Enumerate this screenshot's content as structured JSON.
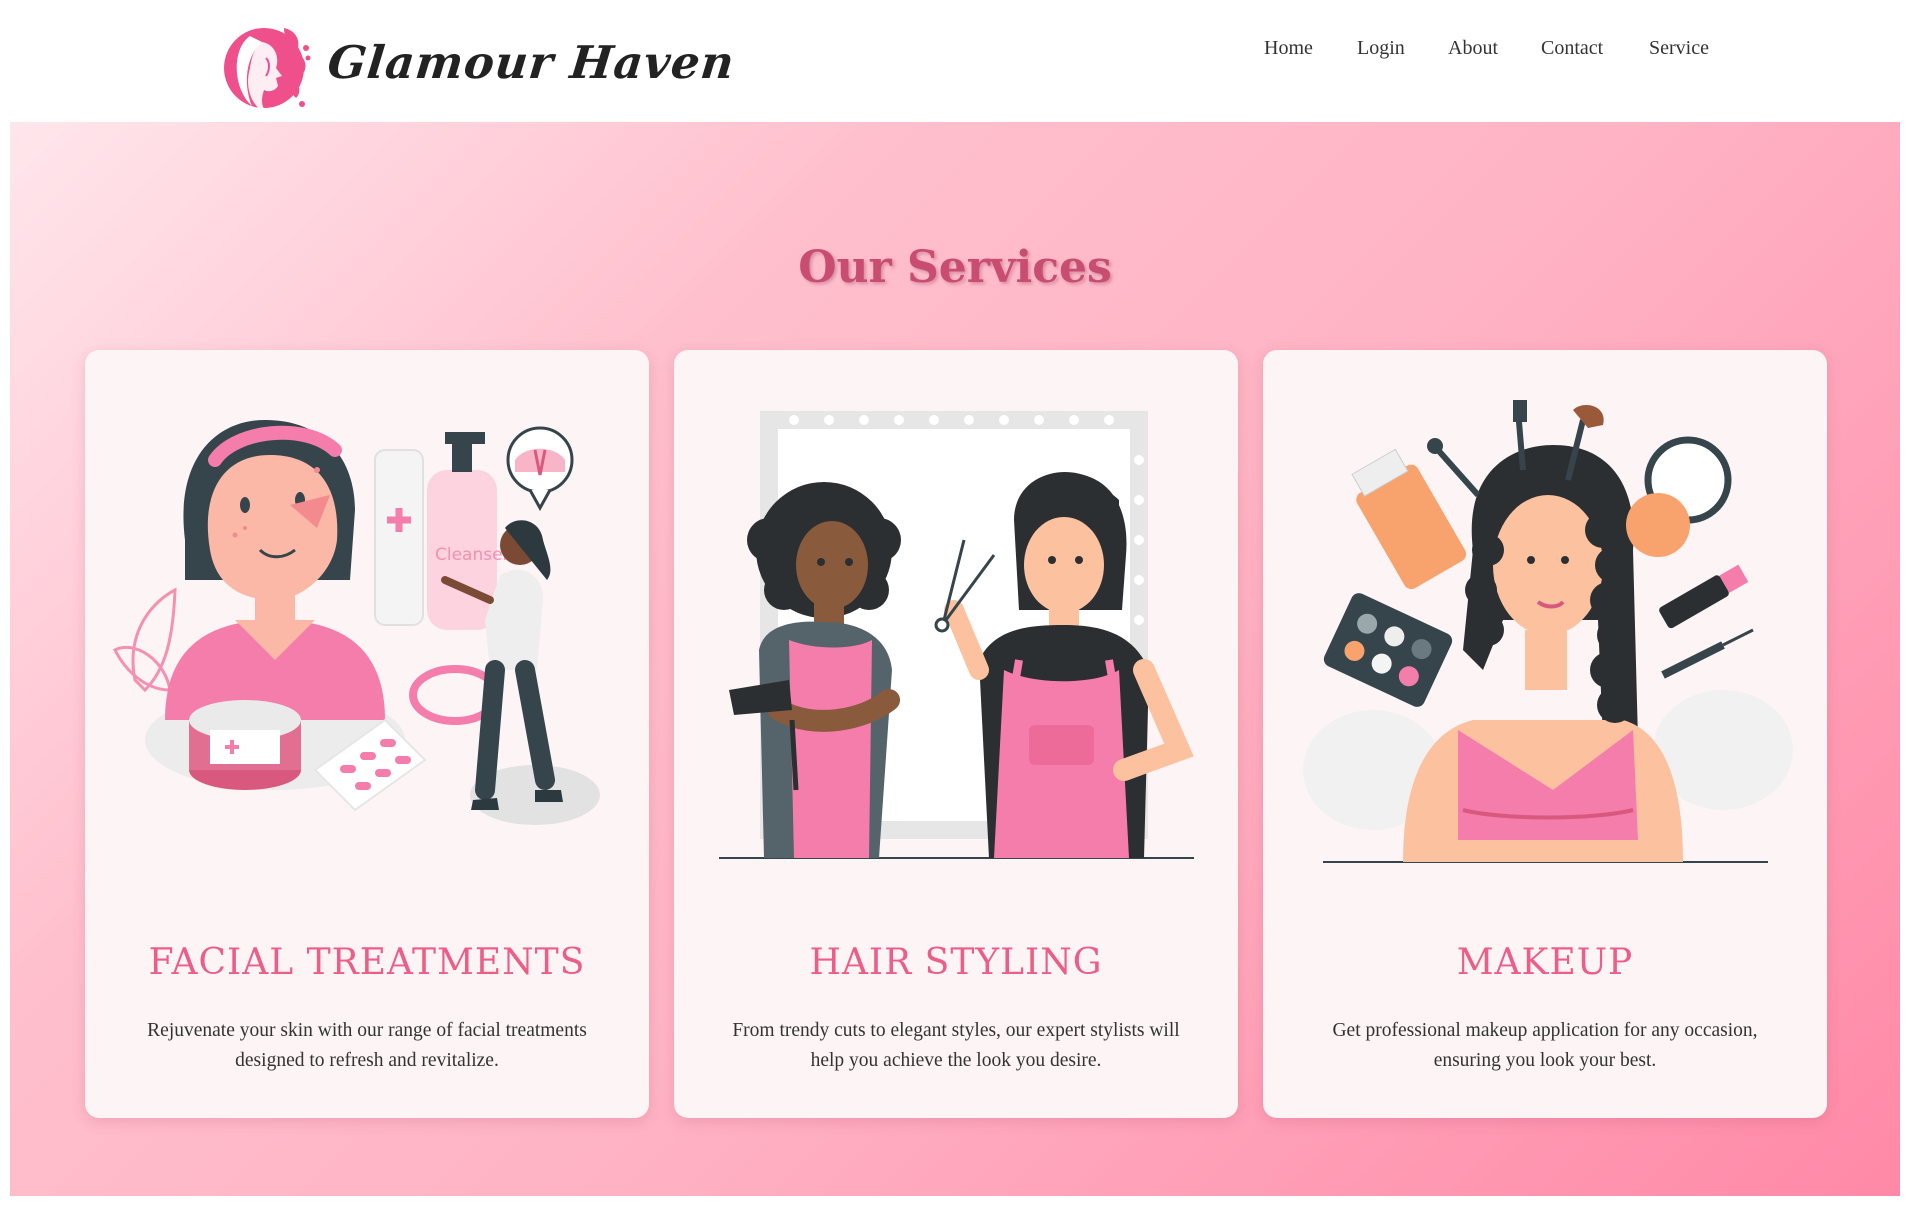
{
  "brand": {
    "name": "Glamour Haven"
  },
  "nav": {
    "home": "Home",
    "login": "Login",
    "about": "About",
    "contact": "Contact",
    "service": "Service"
  },
  "services": {
    "title": "Our Services",
    "cards": [
      {
        "title": "FACIAL TREATMENTS",
        "description": "Rejuvenate your skin with our range of facial treatments designed to refresh and revitalize."
      },
      {
        "title": "HAIR STYLING",
        "description": "From trendy cuts to elegant styles, our expert stylists will help you achieve the look you desire."
      },
      {
        "title": "MAKEUP",
        "description": "Get professional makeup application for any occasion, ensuring you look your best."
      }
    ],
    "illustrations": {
      "facial": {
        "cleanser_label": "Cleanser"
      }
    }
  },
  "colors": {
    "accent": "#ec5d88",
    "title": "#c84d71",
    "brand_pink": "#ee4d86"
  }
}
